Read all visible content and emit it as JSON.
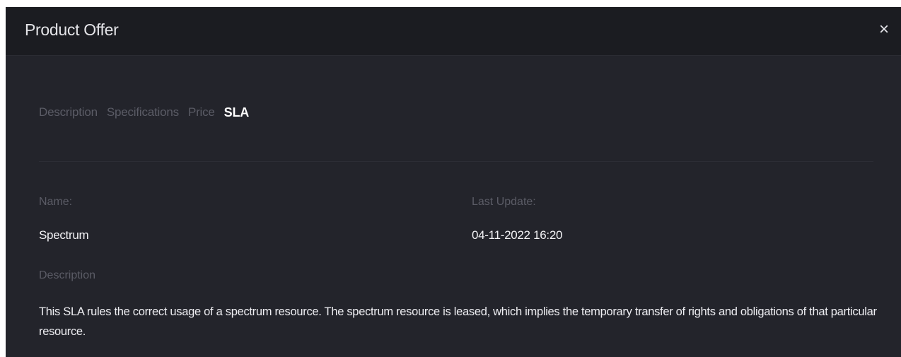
{
  "modal": {
    "title": "Product Offer",
    "close_glyph": "×"
  },
  "tabs": [
    {
      "label": "Description",
      "active": false
    },
    {
      "label": "Specifications",
      "active": false
    },
    {
      "label": "Price",
      "active": false
    },
    {
      "label": "SLA",
      "active": true
    }
  ],
  "sla": {
    "name_label": "Name:",
    "name_value": "Spectrum",
    "last_update_label": "Last Update:",
    "last_update_value": "04-11-2022 16:20",
    "description_label": "Description",
    "description_text": "This SLA rules the correct usage of a spectrum resource. The spectrum resource is leased, which implies the temporary transfer of rights and obligations of that particular resource."
  }
}
